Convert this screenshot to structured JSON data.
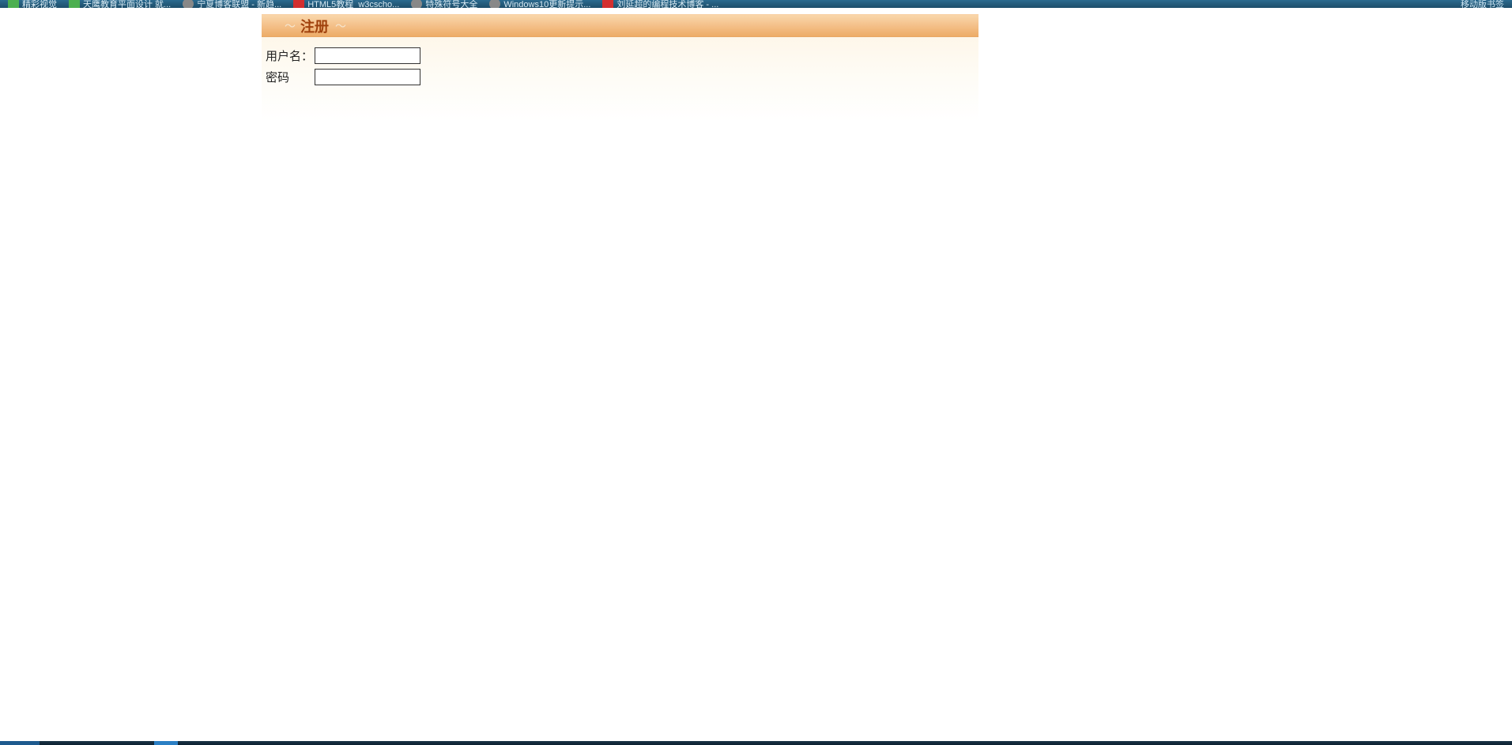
{
  "bookmarks": {
    "items": [
      {
        "label": "精彩视觉",
        "iconClass": "green"
      },
      {
        "label": "天鹰教育平面设计 就...",
        "iconClass": "green"
      },
      {
        "label": "宁夏博客联盟 - 新趋...",
        "iconClass": "gray"
      },
      {
        "label": "HTML5教程_w3cscho...",
        "iconClass": "red"
      },
      {
        "label": "特殊符号大全",
        "iconClass": "gray"
      },
      {
        "label": "Windows10更新提示...",
        "iconClass": "gray"
      },
      {
        "label": "刘延超的编程技术博客 - ...",
        "iconClass": "red"
      }
    ],
    "rightLabel": "移动版书签"
  },
  "panel": {
    "title": "注册",
    "decoLeft": "〜",
    "decoRight": "〜"
  },
  "form": {
    "username": {
      "label": "用户名：",
      "value": ""
    },
    "password": {
      "label": "密码",
      "value": ""
    }
  }
}
